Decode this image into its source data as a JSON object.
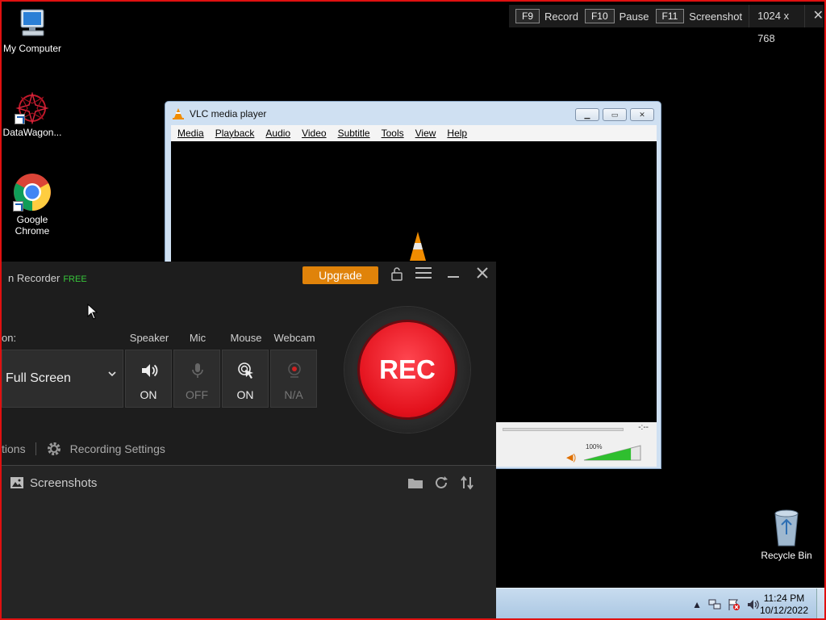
{
  "desktop": {
    "icons": [
      {
        "label": "My Computer",
        "icon": "computer-icon"
      },
      {
        "label": "DataWagon...",
        "icon": "datawagon-icon"
      },
      {
        "label": "Google Chrome",
        "icon": "chrome-icon"
      },
      {
        "label": "Recycle Bin",
        "icon": "recycle-bin-icon"
      }
    ]
  },
  "hotkeys": {
    "record_key": "F9",
    "record_label": "Record",
    "pause_key": "F10",
    "pause_label": "Pause",
    "shot_key": "F11",
    "shot_label": "Screenshot",
    "resolution": "1024 x 768",
    "close": "✕"
  },
  "vlc": {
    "title": "VLC media player",
    "menu": [
      "Media",
      "Playback",
      "Audio",
      "Video",
      "Subtitle",
      "Tools",
      "View",
      "Help"
    ],
    "time": "-:--",
    "volume_label": "100%",
    "volume_level": 1.0,
    "accent": "#f08c00"
  },
  "recorder": {
    "title": "n Recorder",
    "edition": "FREE",
    "upgrade_label": "Upgrade",
    "source_label": "on:",
    "source_value": "Full Screen",
    "toggles": [
      {
        "name": "Speaker",
        "state": "ON"
      },
      {
        "name": "Mic",
        "state": "OFF"
      },
      {
        "name": "Mouse",
        "state": "ON"
      },
      {
        "name": "Webcam",
        "state": "N/A"
      }
    ],
    "rec_label": "REC",
    "options_label": "tions",
    "settings_label": "Recording Settings",
    "tab_label": "Screenshots",
    "colors": {
      "accent": "#e0830a",
      "rec": "#e3111c",
      "free": "#37c53a"
    }
  },
  "taskbar": {
    "time": "11:24 PM",
    "date": "10/12/2022"
  }
}
